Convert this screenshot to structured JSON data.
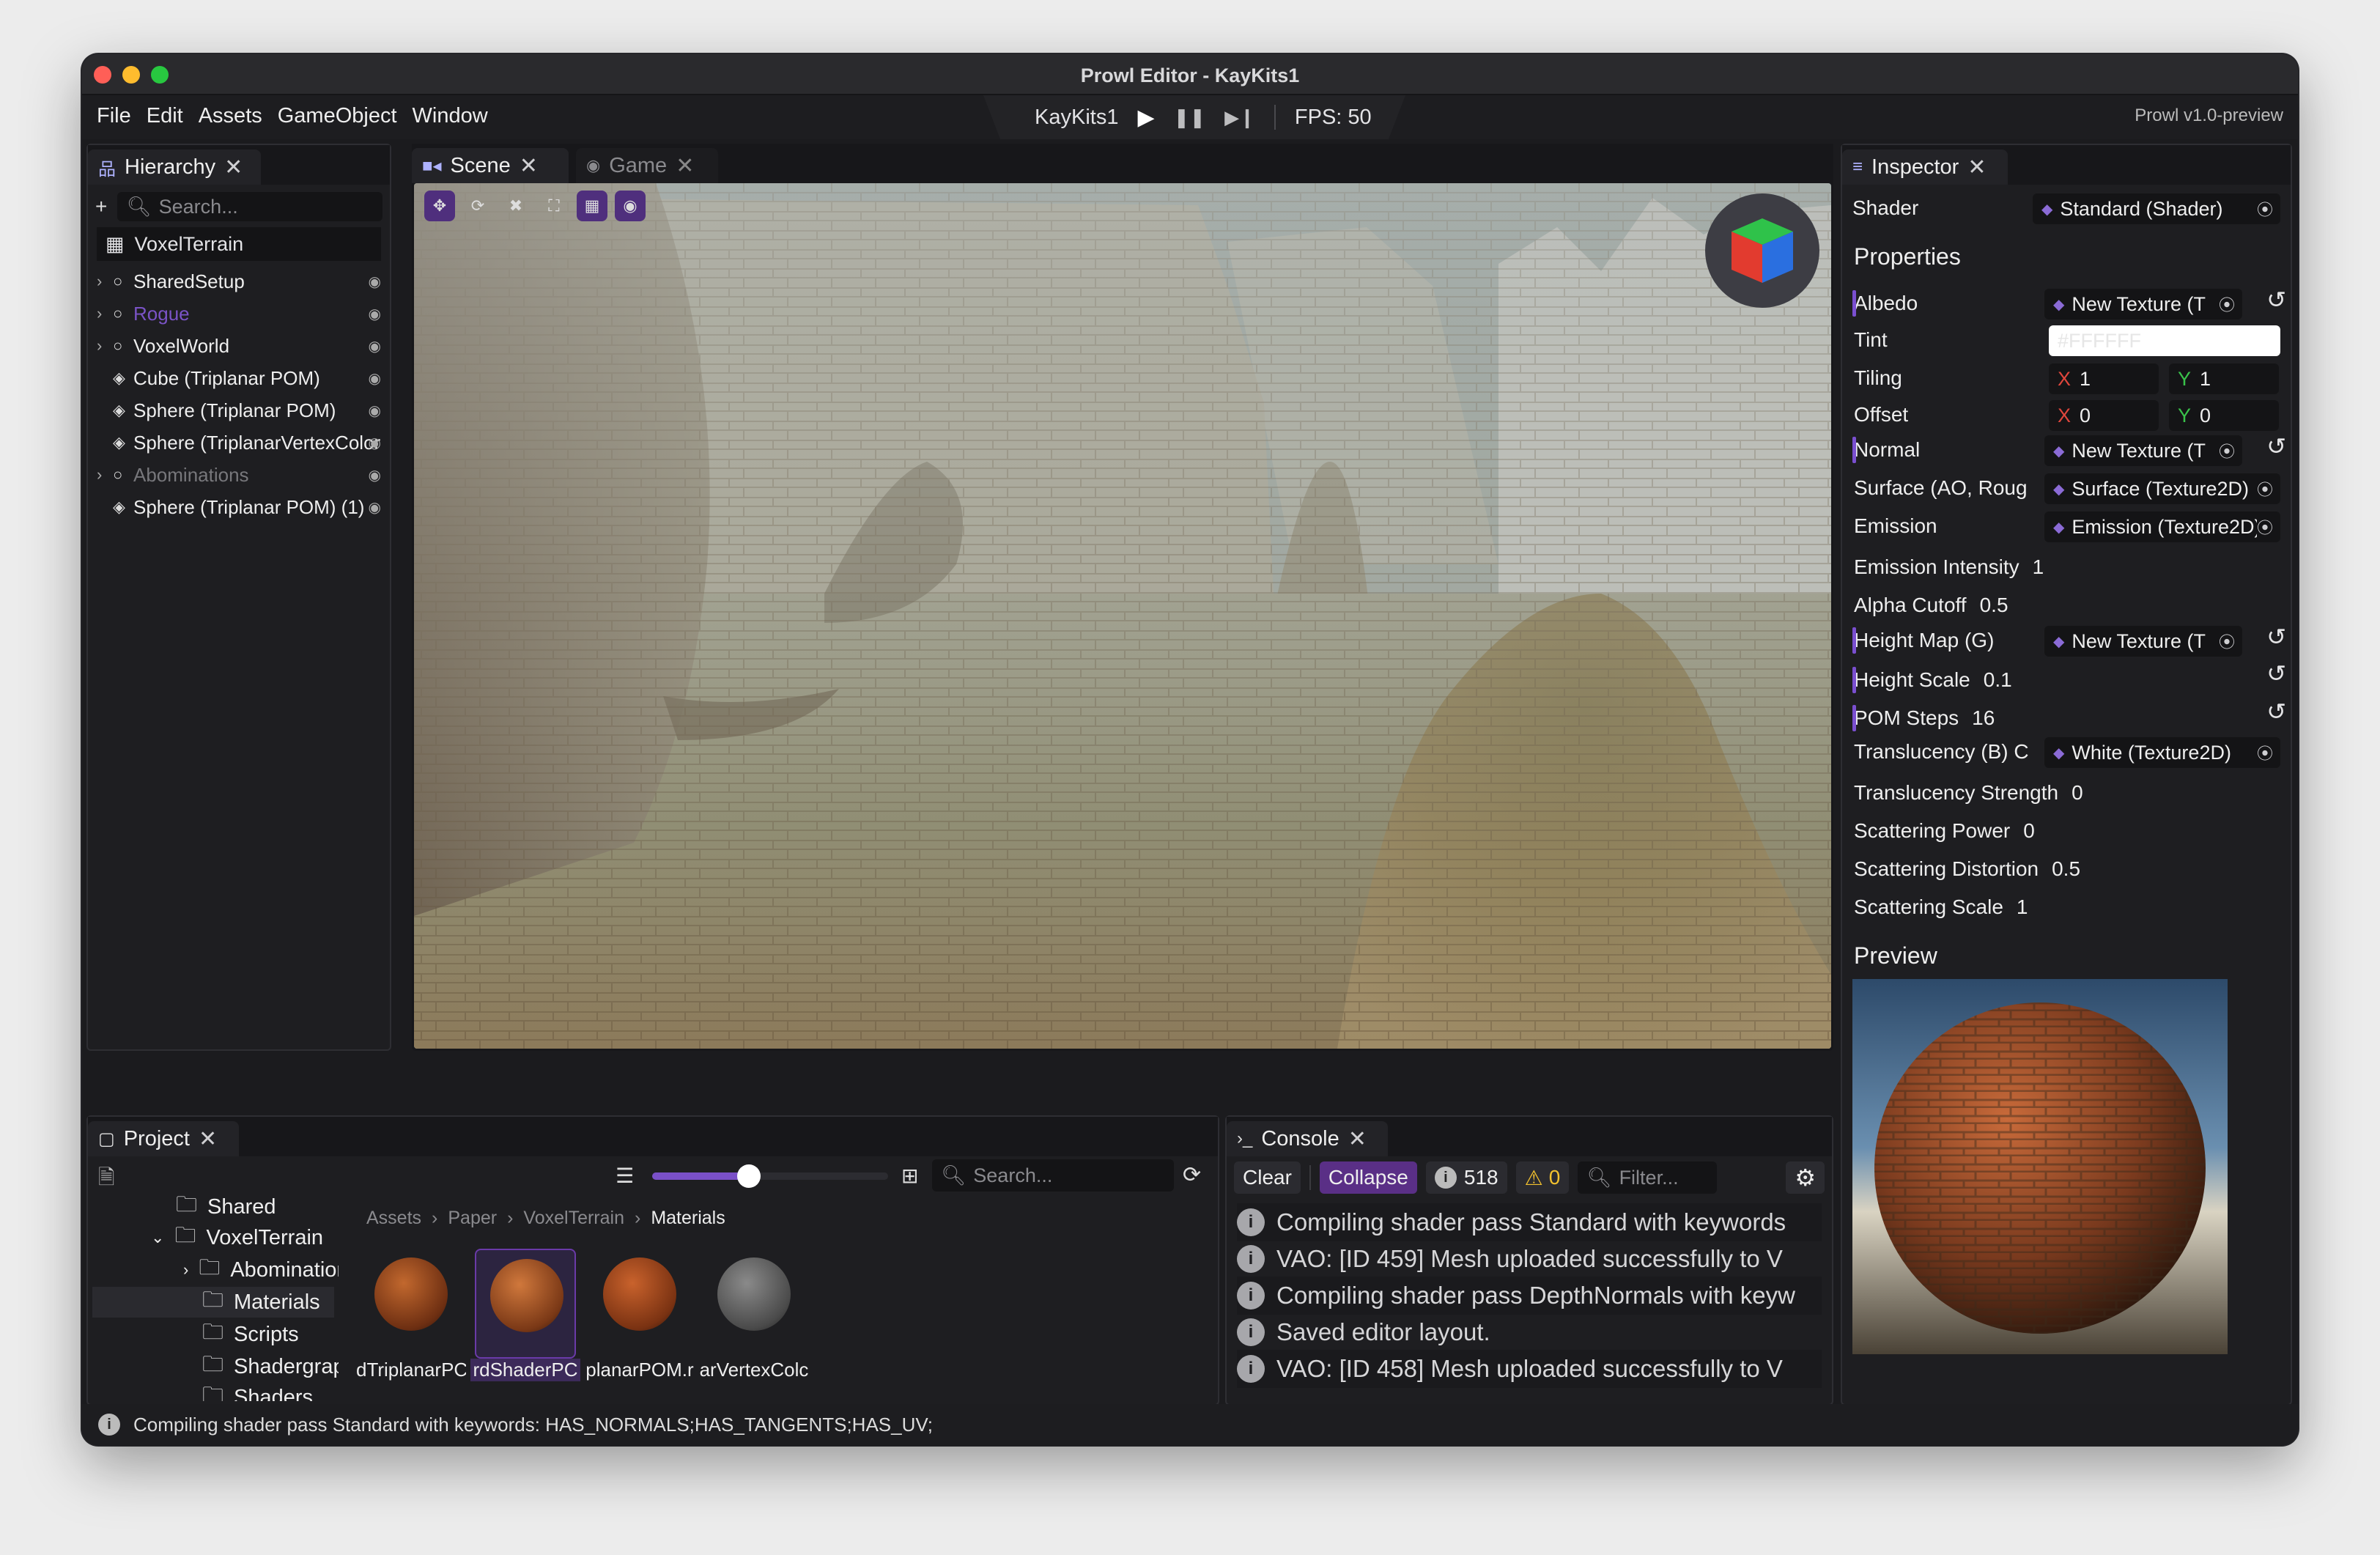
{
  "window": {
    "title": "Prowl Editor - KayKits1"
  },
  "menu": [
    "File",
    "Edit",
    "Assets",
    "GameObject",
    "Window"
  ],
  "playbar": {
    "project": "KayKits1",
    "fps": "FPS: 50"
  },
  "version": "Prowl v1.0-preview",
  "hierarchy": {
    "tab": "Hierarchy",
    "search_placeholder": "Search...",
    "root": "VoxelTerrain",
    "items": [
      {
        "label": "SharedSetup",
        "expandable": true,
        "color": "#eeeeee"
      },
      {
        "label": "Rogue",
        "expandable": true,
        "color": "#7a53c6"
      },
      {
        "label": "VoxelWorld",
        "expandable": true,
        "color": "#eeeeee"
      },
      {
        "label": "Cube (Triplanar POM)",
        "expandable": false,
        "color": "#eeeeee"
      },
      {
        "label": "Sphere (Triplanar POM)",
        "expandable": false,
        "color": "#eeeeee"
      },
      {
        "label": "Sphere (TriplanarVertexColor",
        "expandable": false,
        "color": "#eeeeee"
      },
      {
        "label": "Abominations",
        "expandable": true,
        "color": "#77777b"
      },
      {
        "label": "Sphere (Triplanar POM) (1)",
        "expandable": false,
        "color": "#eeeeee"
      }
    ]
  },
  "scene": {
    "tab_scene": "Scene",
    "tab_game": "Game"
  },
  "inspector": {
    "tab": "Inspector",
    "shader_label": "Shader",
    "shader_value": "Standard (Shader)",
    "properties_heading": "Properties",
    "albedo": {
      "label": "Albedo",
      "value": "New Texture (T"
    },
    "tint": {
      "label": "Tint",
      "value": "#FFFFFF"
    },
    "tiling": {
      "label": "Tiling",
      "x": "1",
      "y": "1"
    },
    "offset": {
      "label": "Offset",
      "x": "0",
      "y": "0"
    },
    "normal": {
      "label": "Normal",
      "value": "New Texture (T"
    },
    "surface": {
      "label": "Surface (AO, Roug",
      "value": "Surface (Texture2D)"
    },
    "emission": {
      "label": "Emission",
      "value": "Emission (Texture2D)"
    },
    "emission_intensity": {
      "label": "Emission Intensity",
      "value": "1"
    },
    "alpha_cutoff": {
      "label": "Alpha Cutoff",
      "value": "0.5"
    },
    "height_map": {
      "label": "Height Map (G)",
      "value": "New Texture (T"
    },
    "height_scale": {
      "label": "Height Scale",
      "value": "0.1"
    },
    "pom_steps": {
      "label": "POM Steps",
      "value": "16"
    },
    "translucency": {
      "label": "Translucency (B) C",
      "value": "White (Texture2D)"
    },
    "translucency_strength": {
      "label": "Translucency Strength",
      "value": "0"
    },
    "scattering_power": {
      "label": "Scattering Power",
      "value": "0"
    },
    "scattering_distortion": {
      "label": "Scattering Distortion",
      "value": "0.5"
    },
    "scattering_scale": {
      "label": "Scattering Scale",
      "value": "1"
    },
    "preview_heading": "Preview"
  },
  "project": {
    "tab": "Project",
    "search_placeholder": "Search...",
    "zoom": 0.41,
    "tree": [
      "Shared",
      "VoxelTerrain",
      "Abomination",
      "Materials",
      "Scripts",
      "Shadergrapl",
      "Shaders"
    ],
    "breadcrumb": [
      "Assets",
      "Paper",
      "VoxelTerrain",
      "Materials"
    ],
    "assets": [
      "dTriplanarPC",
      "rdShaderPC",
      "planarPOM.r",
      "arVertexColc"
    ]
  },
  "console": {
    "tab": "Console",
    "clear": "Clear",
    "collapse": "Collapse",
    "info_count": "518",
    "warn_count": "0",
    "filter_placeholder": "Filter...",
    "lines": [
      "Compiling shader pass Standard with keywords",
      "VAO: [ID 459] Mesh uploaded successfully to V",
      "Compiling shader pass DepthNormals with keyw",
      "Saved editor layout.",
      "VAO: [ID 458] Mesh uploaded successfully to V"
    ]
  },
  "status": {
    "text": "Compiling shader pass Standard with keywords: HAS_NORMALS;HAS_TANGENTS;HAS_UV;"
  },
  "colors": {
    "accent": "#6a3aa8",
    "x_axis": "#e0463c",
    "y_axis": "#39c24a",
    "warning": "#f2c12e"
  }
}
